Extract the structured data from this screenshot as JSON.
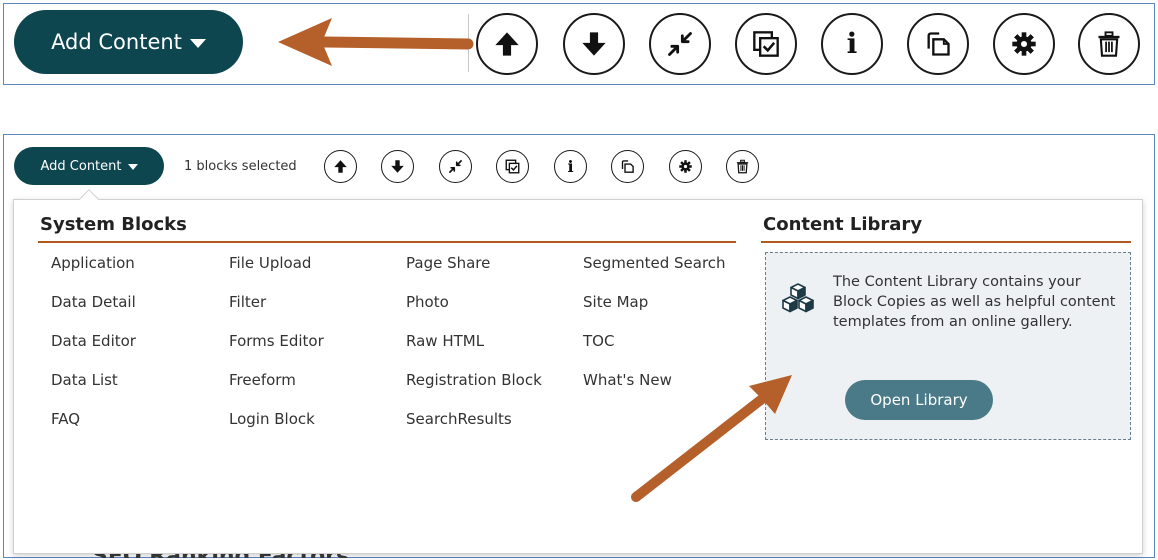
{
  "top_toolbar": {
    "add_content_label": "Add Content",
    "buttons": [
      {
        "icon": "arrow-up-icon",
        "title": "Move Up"
      },
      {
        "icon": "arrow-down-icon",
        "title": "Move Down"
      },
      {
        "icon": "collapse-icon",
        "title": "Collapse"
      },
      {
        "icon": "select-icon",
        "title": "Select"
      },
      {
        "icon": "info-icon",
        "title": "Info"
      },
      {
        "icon": "copy-icon",
        "title": "Copy"
      },
      {
        "icon": "settings-icon",
        "title": "Settings"
      },
      {
        "icon": "trash-icon",
        "title": "Delete"
      }
    ]
  },
  "panel_toolbar": {
    "add_content_label": "Add Content",
    "selection_status": "1 blocks selected"
  },
  "system_blocks": {
    "title": "System Blocks",
    "columns": [
      [
        "Application",
        "Data Detail",
        "Data Editor",
        "Data List",
        "FAQ"
      ],
      [
        "File Upload",
        "Filter",
        "Forms Editor",
        "Freeform",
        "Login Block"
      ],
      [
        "Page Share",
        "Photo",
        "Raw HTML",
        "Registration Block",
        "SearchResults"
      ],
      [
        "Segmented Search",
        "Site Map",
        "TOC",
        "What's New"
      ]
    ]
  },
  "content_library": {
    "title": "Content Library",
    "description": "The Content Library contains your Block Copies as well as helpful content templates from an online gallery.",
    "open_button_label": "Open Library"
  },
  "background_text": "SEO Ranking Factors",
  "colors": {
    "primary_dark": "#0e4650",
    "library_button": "#4a7a88",
    "accent_rule": "#b05a20",
    "annotation_arrow": "#b5602a",
    "frame_border": "#5b86c4"
  }
}
